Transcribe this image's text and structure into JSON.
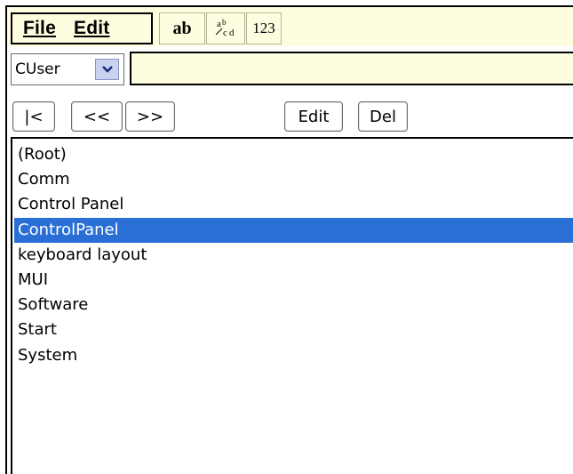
{
  "menubar": {
    "menus": [
      {
        "label": "File"
      },
      {
        "label": "Edit"
      }
    ],
    "input_modes": {
      "ab": "ab",
      "sym_a": "a",
      "sym_b": "b",
      "sym_c": "c",
      "sym_d": "d",
      "num": "123"
    }
  },
  "hive": {
    "selected": "CUser"
  },
  "path_field": {
    "value": ""
  },
  "toolbar": {
    "first": "|<",
    "prev": "<<",
    "next": ">>",
    "edit": "Edit",
    "del": "Del"
  },
  "keys": {
    "items": [
      {
        "label": "(Root)"
      },
      {
        "label": "Comm"
      },
      {
        "label": "Control Panel"
      },
      {
        "label": "ControlPanel"
      },
      {
        "label": "keyboard layout"
      },
      {
        "label": "MUI"
      },
      {
        "label": "Software"
      },
      {
        "label": "Start"
      },
      {
        "label": "System"
      }
    ],
    "selected_index": 3
  },
  "colors": {
    "menu_bg": "#fffde0",
    "selection": "#2a6fd6"
  }
}
